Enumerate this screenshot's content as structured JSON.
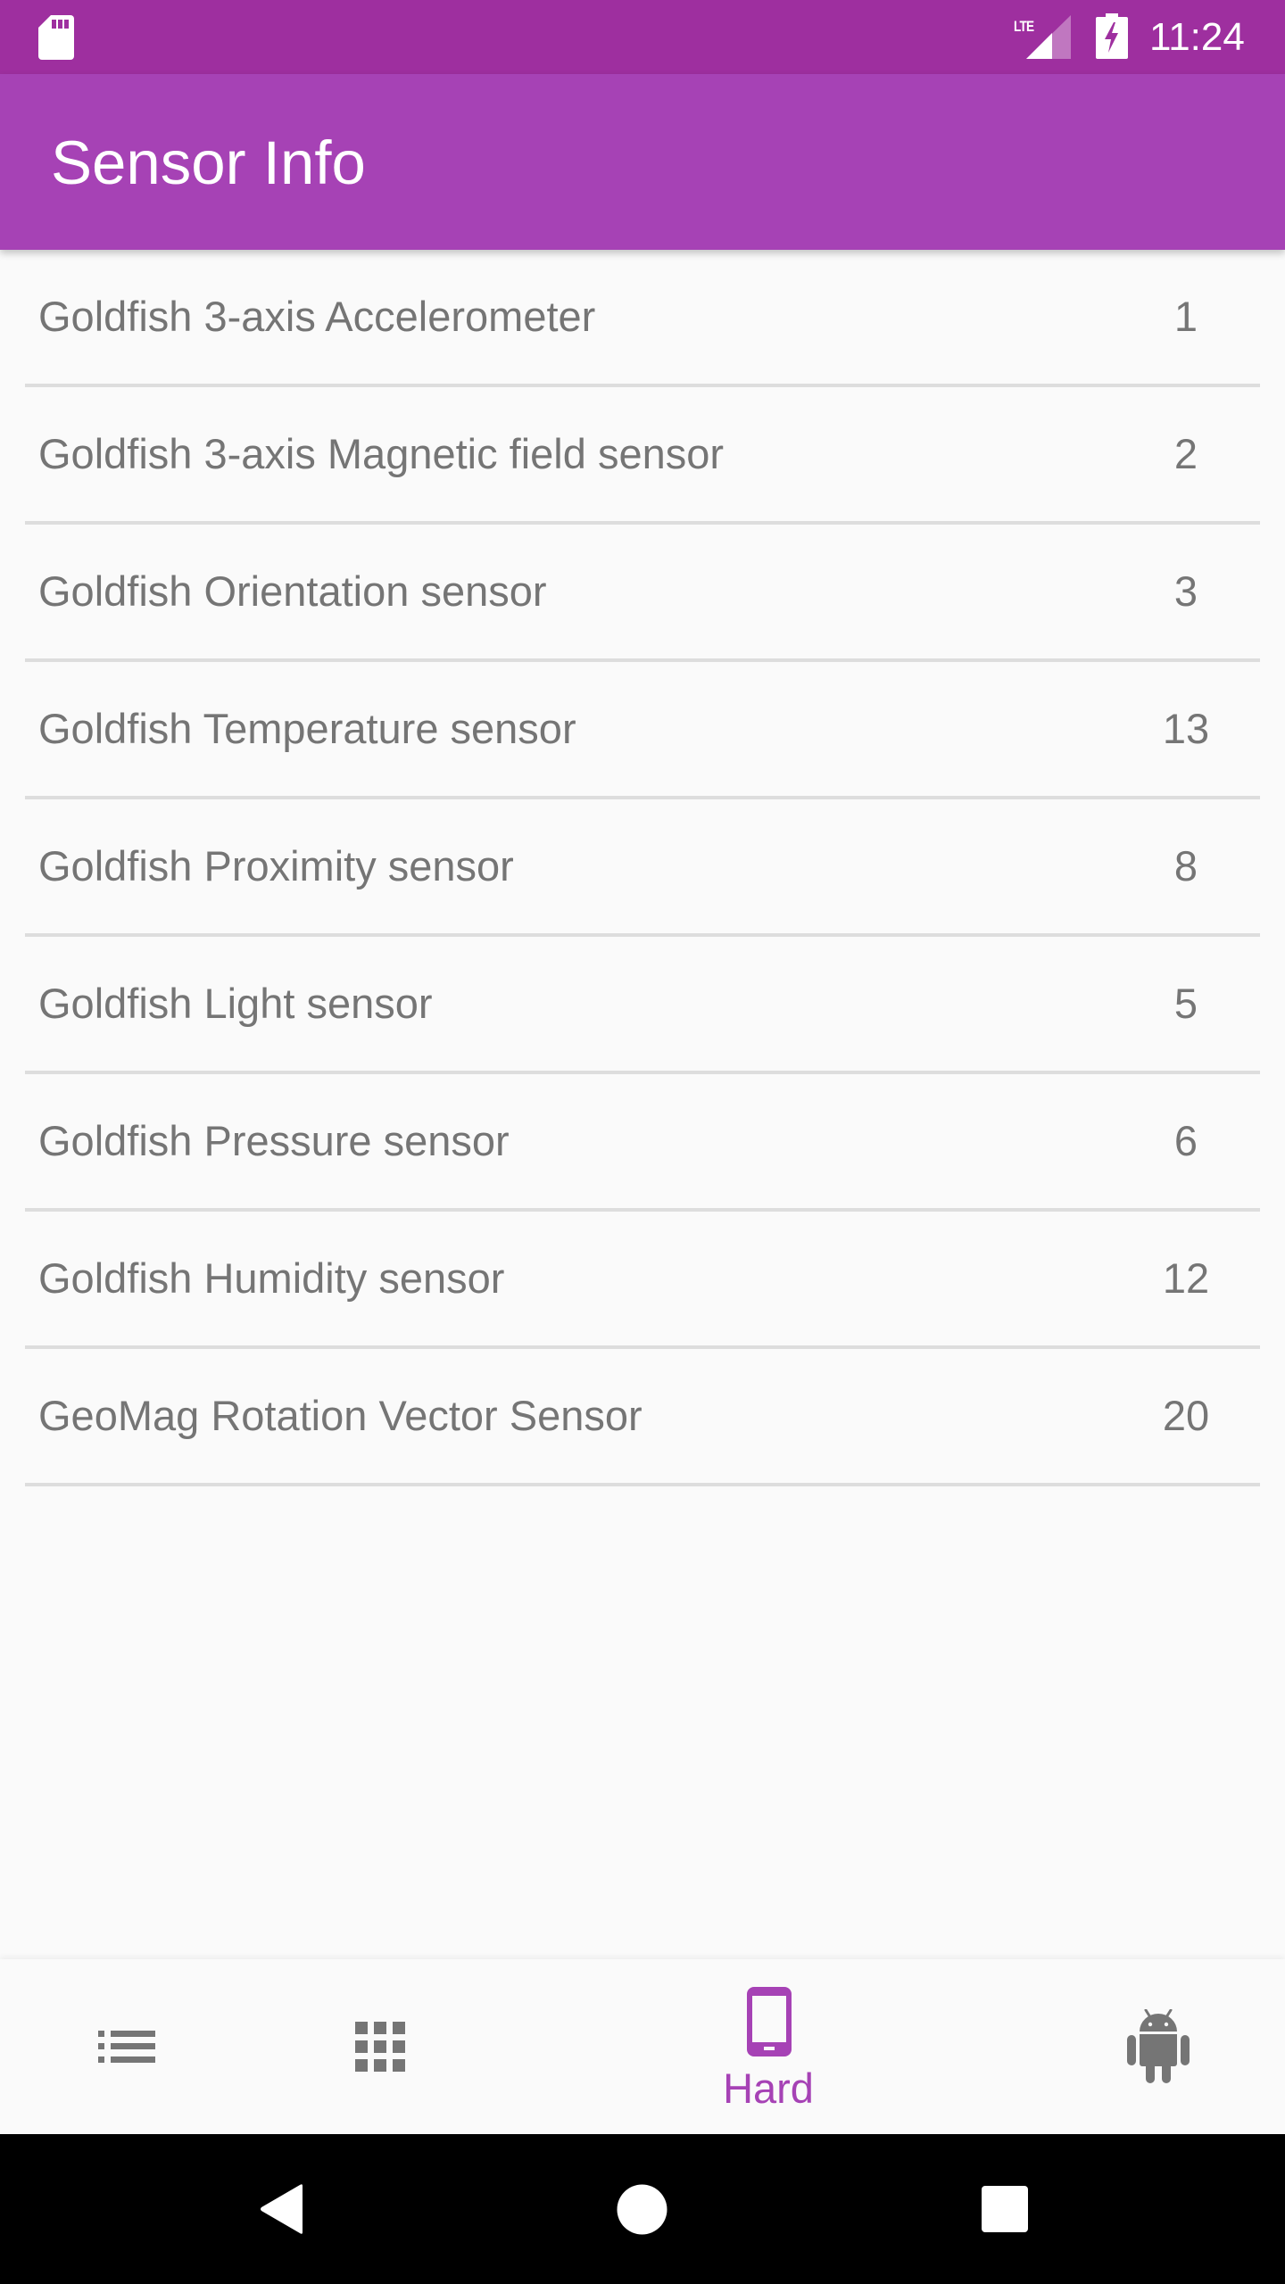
{
  "status_bar": {
    "time": "11:24",
    "network_label": "LTE",
    "icons": [
      "sd-card-icon",
      "lte-signal-icon",
      "battery-charging-icon"
    ]
  },
  "app_bar": {
    "title": "Sensor Info"
  },
  "sensors": [
    {
      "name": "Goldfish 3-axis Accelerometer",
      "type": "1"
    },
    {
      "name": "Goldfish 3-axis Magnetic field sensor",
      "type": "2"
    },
    {
      "name": "Goldfish Orientation sensor",
      "type": "3"
    },
    {
      "name": "Goldfish Temperature sensor",
      "type": "13"
    },
    {
      "name": "Goldfish Proximity sensor",
      "type": "8"
    },
    {
      "name": "Goldfish Light sensor",
      "type": "5"
    },
    {
      "name": "Goldfish Pressure sensor",
      "type": "6"
    },
    {
      "name": "Goldfish Humidity sensor",
      "type": "12"
    },
    {
      "name": "GeoMag Rotation Vector Sensor",
      "type": "20"
    }
  ],
  "bottom_nav": {
    "items": [
      {
        "icon": "list-icon",
        "label": "",
        "active": false
      },
      {
        "icon": "grid-icon",
        "label": "",
        "active": false
      },
      {
        "icon": "phone-icon",
        "label": "Hard",
        "active": true
      },
      {
        "icon": "android-icon",
        "label": "",
        "active": false
      }
    ],
    "active_color": "#A642B5",
    "inactive_color": "#757575"
  },
  "system_nav": {
    "buttons": [
      "back",
      "home",
      "recents"
    ]
  },
  "colors": {
    "status_bar": "#9E2F9F",
    "app_bar": "#A642B5",
    "background": "#FAFAFA",
    "text_secondary": "#757575",
    "divider": "#DDDDDD"
  }
}
